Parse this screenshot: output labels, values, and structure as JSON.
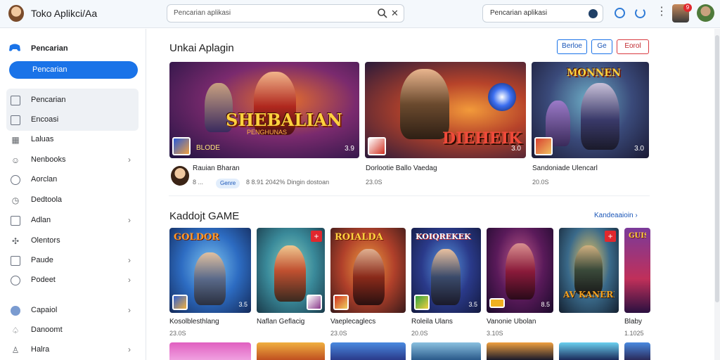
{
  "app": {
    "title": "Toko Aplikci/Aa"
  },
  "header": {
    "search_placeholder": "Pencarian aplikasi",
    "secondary_search_placeholder": "Pencarian aplikasi",
    "notification_count": "9"
  },
  "sidebar": {
    "heading": "Pencarian",
    "primary_button": "Pencarian",
    "items": [
      {
        "label": "Pencarian",
        "icon": "square-icon",
        "chevron": false
      },
      {
        "label": "Encoasi",
        "icon": "square-icon",
        "chevron": false
      },
      {
        "label": "Laluas",
        "icon": "grid-icon",
        "chevron": false
      },
      {
        "label": "Nenbooks",
        "icon": "smiley-icon",
        "chevron": true
      },
      {
        "label": "Aorclan",
        "icon": "circle-icon",
        "chevron": false
      },
      {
        "label": "Dedtoola",
        "icon": "clock-icon",
        "chevron": false
      },
      {
        "label": "Adlan",
        "icon": "window-icon",
        "chevron": true
      },
      {
        "label": "Olentors",
        "icon": "puzzle-icon",
        "chevron": false
      },
      {
        "label": "Paude",
        "icon": "document-icon",
        "chevron": true
      },
      {
        "label": "Podeet",
        "icon": "circle-icon",
        "chevron": true
      },
      {
        "label": "Capaiol",
        "icon": "blue-dot-icon",
        "chevron": true
      },
      {
        "label": "Danoomt",
        "icon": "bell-icon",
        "chevron": false
      },
      {
        "label": "Halra",
        "icon": "person-icon",
        "chevron": true
      }
    ]
  },
  "featured": {
    "title": "Unkai Aplagin",
    "actions": [
      "Berloe",
      "Ge",
      "Eorol"
    ],
    "items": [
      {
        "art_title": "SHEBALIAN",
        "art_sub": "PENGHUNAS",
        "mini_label": "BLODE",
        "rating": "3.9",
        "name": "Rauian Bharan",
        "meta": "8 ...",
        "tag": "Genre",
        "extra": "8 8.91 2042% Dingin dostoan"
      },
      {
        "art_title": "DIEHEIK",
        "art_sub": "",
        "mini_label": "",
        "rating": "3.0",
        "name": "Dorlootie Ballo Vaedag",
        "meta": "23.0S",
        "tag": "",
        "extra": ""
      },
      {
        "art_title": "MONNEN",
        "art_sub": "",
        "mini_label": "",
        "rating": "3.0",
        "name": "Sandoniade Ulencarl",
        "meta": "20.0S",
        "tag": "",
        "extra": ""
      }
    ]
  },
  "games": {
    "title": "Kaddojt GAME",
    "see_all": "Kandeaaioin",
    "items": [
      {
        "art_title": "GOLDOR",
        "rating": "3.5",
        "name": "Kosolblesthlang",
        "meta": "23.0S",
        "plus": false
      },
      {
        "art_title": "",
        "rating": "",
        "name": "Naflan Geflacig",
        "meta": "",
        "plus": true
      },
      {
        "art_title": "ROIALDA",
        "rating": "",
        "name": "Vaeplecaglecs",
        "meta": "23.0S",
        "plus": false
      },
      {
        "art_title": "KOIQREKEK",
        "rating": "3.5",
        "name": "Roleila Ulans",
        "meta": "20.0S",
        "plus": false
      },
      {
        "art_title": "",
        "rating": "8.5",
        "name": "Vanonie Ubolan",
        "meta": "3.10S",
        "plus": false
      },
      {
        "art_title": "AV KANERDAK",
        "rating": "",
        "name": "",
        "meta": "",
        "plus": true
      },
      {
        "art_title": "GUIS",
        "rating": "",
        "name": "Blaby",
        "meta": "1.1025",
        "plus": false
      }
    ]
  },
  "colors": {
    "accent": "#1a73e8",
    "danger": "#d93a40",
    "sidebar_selected": "#eef1f5"
  }
}
